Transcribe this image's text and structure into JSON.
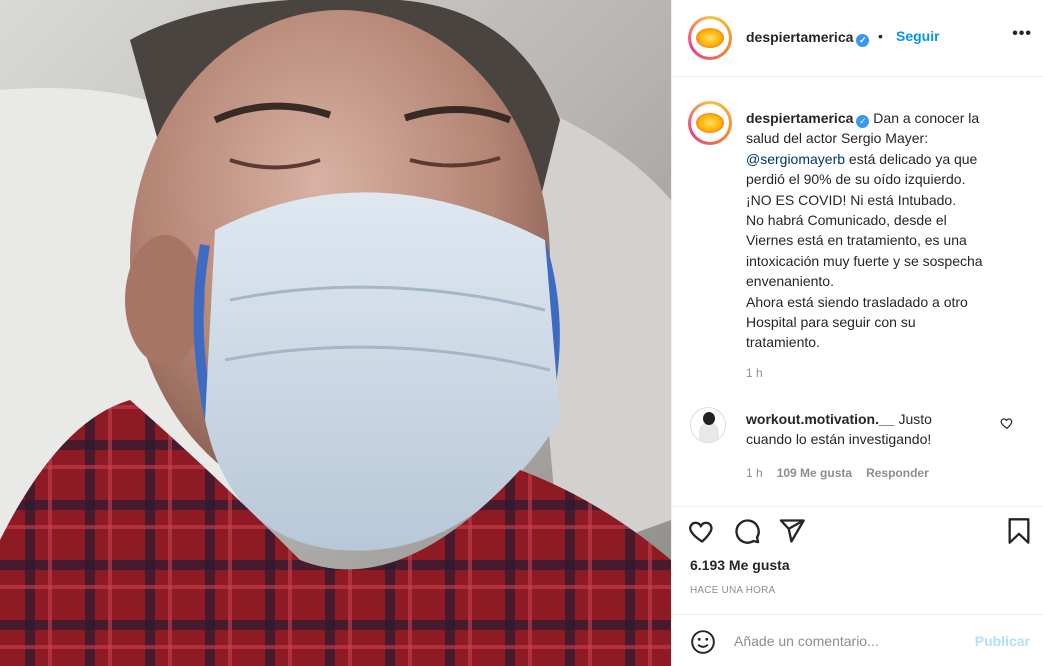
{
  "header": {
    "username": "despiertamerica",
    "separator": "•",
    "follow_label": "Seguir",
    "more_label": "•••"
  },
  "caption": {
    "username": "despiertamerica",
    "lines": [
      "Dan a conocer la",
      "salud del actor Sergio Mayer:",
      "@sergiomayerb",
      " está delicado ya que",
      "perdió el 90% de su oído izquierdo.",
      "¡NO ES COVID! Ni está Intubado.",
      "No habrá Comunicado, desde el",
      "Viernes está en tratamiento, es una",
      "intoxicación muy fuerte y se sospecha",
      "envenaniento.",
      "Ahora está siendo trasladado a otro",
      "Hospital para seguir con su",
      "tratamiento."
    ],
    "time": "1 h"
  },
  "comment": {
    "username": "workout.motivation.__",
    "text_line1": "Justo",
    "text_line2": "cuando lo están investigando!",
    "time": "1 h",
    "likes": "109 Me gusta",
    "reply_label": "Responder"
  },
  "stats": {
    "likes": "6.193 Me gusta",
    "posted": "HACE UNA HORA"
  },
  "add_comment": {
    "placeholder": "Añade un comentario...",
    "publish_label": "Publicar"
  },
  "icons": {
    "verified": "verified-badge-icon",
    "like": "heart-icon",
    "comment": "comment-bubble-icon",
    "share": "paper-plane-icon",
    "save": "bookmark-icon",
    "emoji": "smiley-icon"
  },
  "colors": {
    "link_blue": "#0095f6",
    "verified_blue": "#3897f0",
    "mention": "#00376b",
    "muted": "#8e8e8e",
    "publish_disabled": "#b2dffc"
  }
}
